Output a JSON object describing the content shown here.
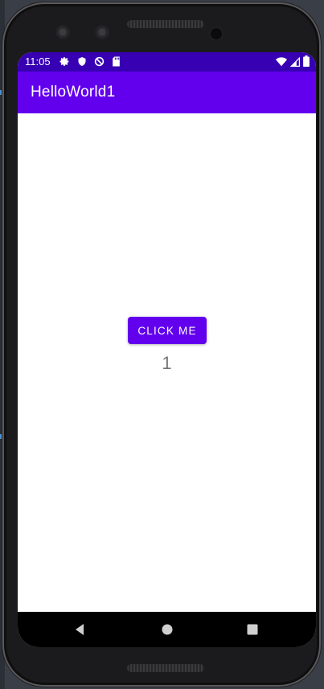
{
  "status_bar": {
    "time": "11:05",
    "left_icons": [
      "gear-icon",
      "shield-icon",
      "data-saver-icon",
      "sd-card-icon"
    ],
    "right_icons": [
      "wifi-icon",
      "signal-icon",
      "battery-icon"
    ]
  },
  "app_bar": {
    "title": "HelloWorld1"
  },
  "main": {
    "button_label": "CLICK ME",
    "counter_value": "1"
  },
  "nav_bar": {
    "buttons": [
      "back-icon",
      "home-icon",
      "recents-icon"
    ]
  },
  "colors": {
    "status_bar": "#3700b3",
    "app_bar": "#6200ee",
    "button": "#6200ee",
    "counter_text": "#757575",
    "nav_bar": "#000000"
  }
}
